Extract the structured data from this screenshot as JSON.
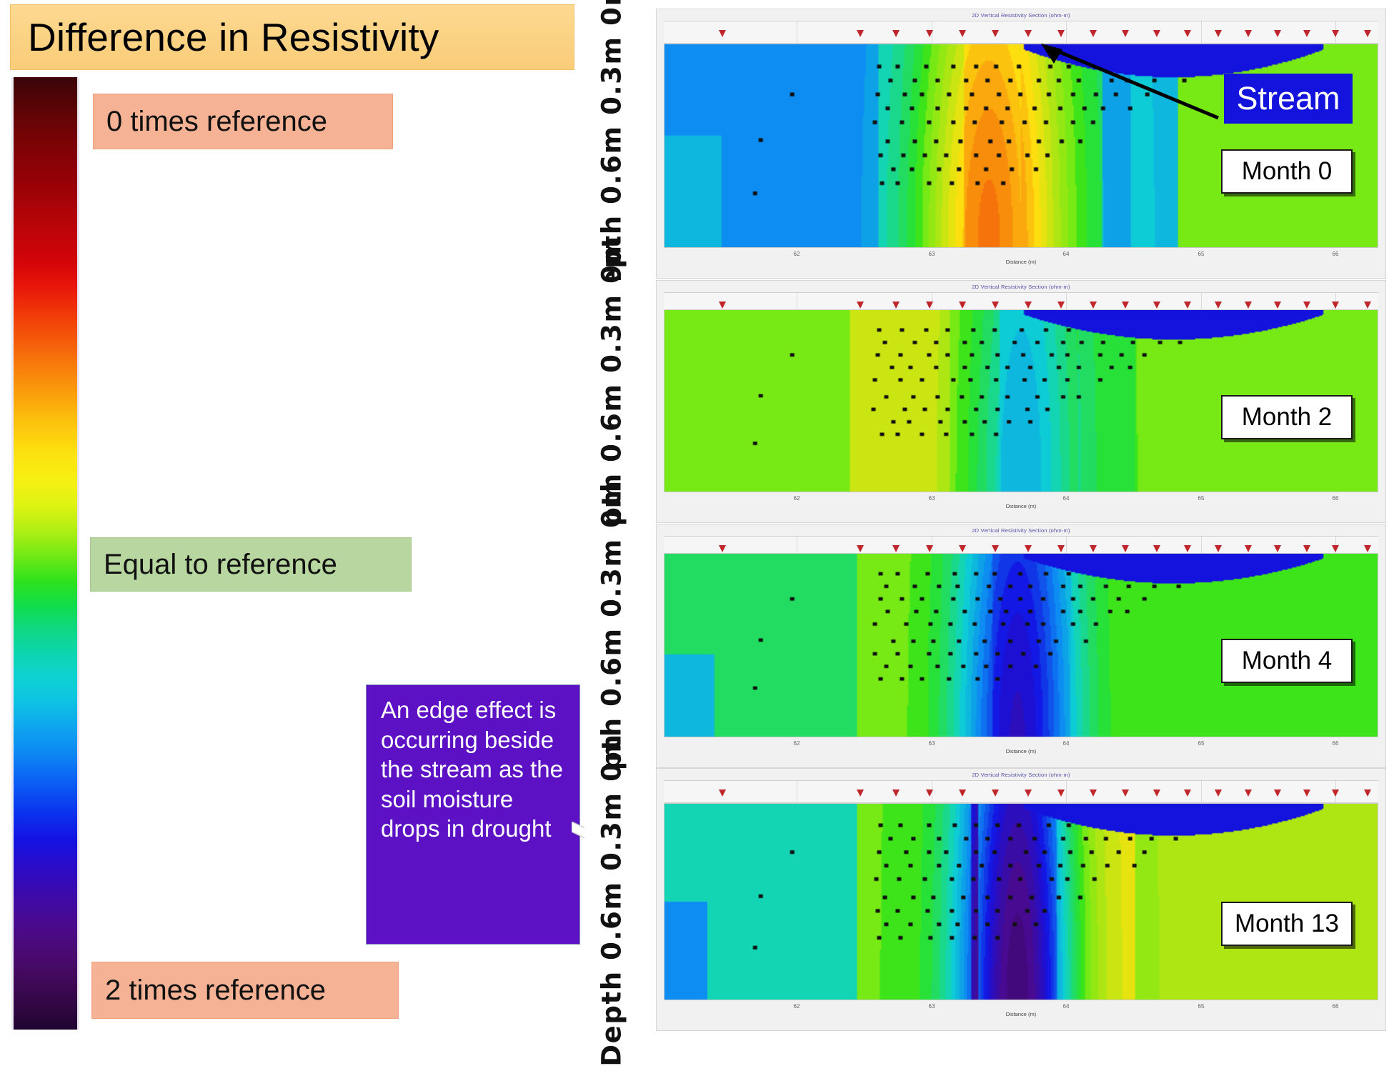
{
  "title": {
    "text": "Difference in Resistivity",
    "bg_color": "#fbd385"
  },
  "legend": {
    "top_label": "0 times reference",
    "middle_label": "Equal to reference",
    "bottom_label": "2 times reference",
    "top_bg": "#f6b294",
    "middle_bg": "#b7d6a0",
    "bottom_bg": "#f6b294",
    "colorbar_top_color": "#3a0508",
    "colorbar_middle_color": "#2ce21c",
    "colorbar_bottom_color": "#1e0530"
  },
  "annotation": {
    "text": "An edge effect is occurring beside the stream as the soil moisture drops in drought",
    "bg_color": "#5c12c4",
    "text_color": "#ffffff",
    "arrow_color": "#ffffff"
  },
  "stream_callout": {
    "label": "Stream",
    "bg_color": "#1313dd",
    "text_color": "#ffffff",
    "arrow_color": "#000000"
  },
  "axis": {
    "y_label": "Depth  0.6m 0.3m 0m",
    "y_ticks": [
      "0m",
      "0.3m",
      "0.6m"
    ],
    "x_title": "Distance (m)",
    "x_ticks": [
      "62",
      "63",
      "64",
      "65",
      "66"
    ],
    "chart_title": "2D Vertical Resistivity Section (ohm-m)"
  },
  "panels": [
    {
      "tag": "Month 0",
      "month": 0
    },
    {
      "tag": "Month 2",
      "month": 2
    },
    {
      "tag": "Month 4",
      "month": 4
    },
    {
      "tag": "Month 13",
      "month": 13
    }
  ],
  "chart_data": {
    "type": "heatmap",
    "title": "2D Vertical Resistivity Section (ohm-m)",
    "subtitle": "Difference in Resistivity",
    "xlabel": "Distance (m)",
    "ylabel": "Depth",
    "x_ticks": [
      62,
      63,
      64,
      65,
      66
    ],
    "y_ticks": [
      "0m",
      "0.3m",
      "0.6m"
    ],
    "xlim": [
      61.3,
      66.6
    ],
    "ylim": [
      0.0,
      0.75
    ],
    "grid": false,
    "legend_position": "left-vertical-colorbar",
    "colorbar": {
      "orientation": "vertical",
      "top_value_label": "0 times reference",
      "mid_value_label": "Equal to reference",
      "bottom_value_label": "2 times reference",
      "top_value": 0,
      "mid_value": 1,
      "bottom_value": 2,
      "stops": [
        {
          "pos": 0.0,
          "color": "#3a0508"
        },
        {
          "pos": 0.11,
          "color": "#960206"
        },
        {
          "pos": 0.22,
          "color": "#e8160b"
        },
        {
          "pos": 0.3,
          "color": "#f7780b"
        },
        {
          "pos": 0.39,
          "color": "#fde20f"
        },
        {
          "pos": 0.5,
          "color": "#77e915"
        },
        {
          "pos": 0.53,
          "color": "#2ce21c"
        },
        {
          "pos": 0.63,
          "color": "#0ed2d2"
        },
        {
          "pos": 0.71,
          "color": "#0d88f3"
        },
        {
          "pos": 0.8,
          "color": "#1312e3"
        },
        {
          "pos": 0.89,
          "color": "#4a0a8d"
        },
        {
          "pos": 1.0,
          "color": "#1e0530"
        }
      ]
    },
    "series": [
      {
        "name": "Month 0",
        "background_value": 1.18,
        "left_block_value": 1.45,
        "plume_peak_value": 0.62,
        "plume_center_x": 63.7,
        "stream_value": 1.82,
        "description": "Cyan/blue left half, green right half, strong yellow plume below centre, blue stream lens at surface right-of-centre"
      },
      {
        "name": "Month 2",
        "background_value": 1.02,
        "left_block_value": 1.02,
        "plume_peak_value": 0.85,
        "plume_center_x": 63.9,
        "stream_value": 1.85,
        "description": "Mostly green, yellow-green band left of centre, cyan plume below centre"
      },
      {
        "name": "Month 4",
        "background_value": 1.05,
        "left_block_value": 1.12,
        "plume_peak_value": 1.62,
        "plume_center_x": 63.9,
        "stream_value": 1.85,
        "description": "Green field with deep blue plume below centre, teal at far left"
      },
      {
        "name": "Month 13",
        "background_value": 1.22,
        "left_block_value": 1.52,
        "plume_peak_value": 1.95,
        "plume_center_x": 63.85,
        "stream_value": 1.88,
        "description": "Cyan right, blue left, dark purple plume below centre indicating edge effect during drought"
      }
    ],
    "electrode_count": 18,
    "electrode_marker": "red down triangle"
  }
}
